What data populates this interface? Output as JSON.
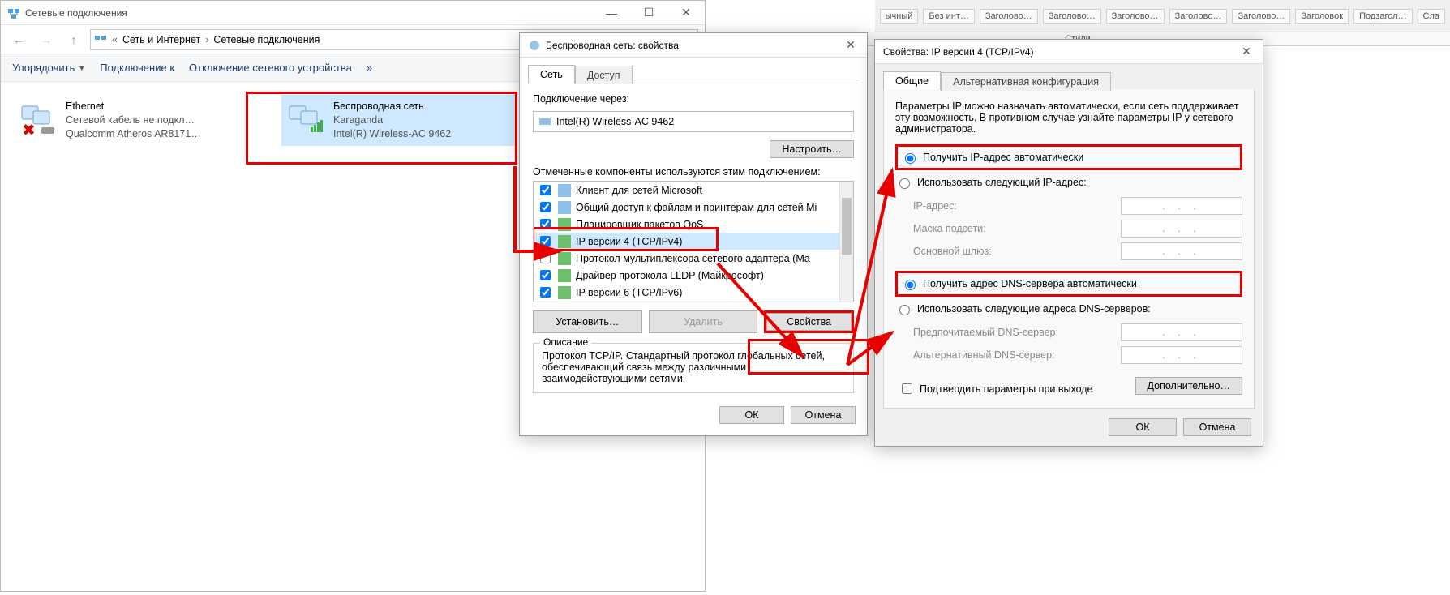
{
  "ribbon": {
    "items": [
      "ычный",
      "Без инт…",
      "Заголово…",
      "Заголово…",
      "Заголово…",
      "Заголово…",
      "Заголово…",
      "Заголовок",
      "Подзагол…",
      "Сла"
    ],
    "styles_label": "Стили"
  },
  "win1": {
    "title": "Сетевые подключения",
    "breadcrumb": {
      "prefix": "«",
      "a": "Сеть и Интернет",
      "b": "Сетевые подключения"
    },
    "cmd": {
      "org": "Упорядочить",
      "connect": "Подключение к",
      "disable": "Отключение сетевого устройства",
      "more": "»"
    },
    "eth": {
      "name": "Ethernet",
      "status": "Сетевой кабель не подкл…",
      "device": "Qualcomm Atheros AR8171…"
    },
    "wifi": {
      "name": "Беспроводная сеть",
      "ssid": "Karaganda",
      "device": "Intel(R) Wireless-AC 9462"
    }
  },
  "win2": {
    "title": "Беспроводная сеть: свойства",
    "tab_net": "Сеть",
    "tab_access": "Доступ",
    "connect_via": "Подключение через:",
    "adapter": "Intel(R) Wireless-AC 9462",
    "configure": "Настроить…",
    "components_label": "Отмеченные компоненты используются этим подключением:",
    "components": [
      {
        "checked": true,
        "label": "Клиент для сетей Microsoft"
      },
      {
        "checked": true,
        "label": "Общий доступ к файлам и принтерам для сетей Mi"
      },
      {
        "checked": true,
        "label": "Планировщик пакетов QoS"
      },
      {
        "checked": true,
        "label": "IP версии 4 (TCP/IPv4)"
      },
      {
        "checked": false,
        "label": "Протокол мультиплексора сетевого адаптера (Ма"
      },
      {
        "checked": true,
        "label": "Драйвер протокола LLDP (Майкрософт)"
      },
      {
        "checked": true,
        "label": "IP версии 6 (TCP/IPv6)"
      }
    ],
    "install": "Установить…",
    "remove": "Удалить",
    "props": "Свойства",
    "desc_title": "Описание",
    "desc_text": "Протокол TCP/IP. Стандартный протокол глобальных сетей, обеспечивающий связь между различными взаимодействующими сетями.",
    "ok": "ОК",
    "cancel": "Отмена"
  },
  "win3": {
    "title": "Свойства: IP версии 4 (TCP/IPv4)",
    "tab_general": "Общие",
    "tab_alt": "Альтернативная конфигурация",
    "intro": "Параметры IP можно назначать автоматически, если сеть поддерживает эту возможность. В противном случае узнайте параметры IP у сетевого администратора.",
    "auto_ip": "Получить IP-адрес автоматически",
    "manual_ip": "Использовать следующий IP-адрес:",
    "ip_label": "IP-адрес:",
    "mask_label": "Маска подсети:",
    "gw_label": "Основной шлюз:",
    "auto_dns": "Получить адрес DNS-сервера автоматически",
    "manual_dns": "Использовать следующие адреса DNS-серверов:",
    "dns1_label": "Предпочитаемый DNS-сервер:",
    "dns2_label": "Альтернативный DNS-сервер:",
    "confirm_exit": "Подтвердить параметры при выходе",
    "advanced": "Дополнительно…",
    "ok": "ОК",
    "cancel": "Отмена"
  }
}
